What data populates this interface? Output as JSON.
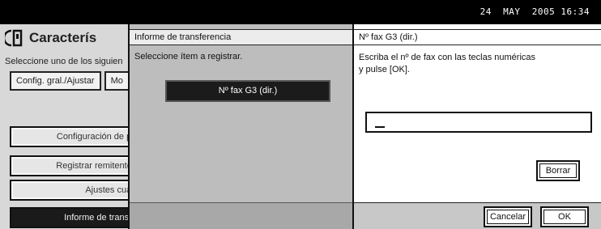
{
  "status_bar": {
    "date": "24  MAY",
    "time": "2005 16:34"
  },
  "left_panel": {
    "title": "Caracterís",
    "instruction": "Seleccione uno de los siguien",
    "tabs": [
      "Config. gral./Ajustar",
      "Mo"
    ],
    "buttons": [
      "Configuración de par",
      "Registrar remitente e",
      "Ajustes cuadr",
      "Informe de transfer"
    ]
  },
  "middle_panel": {
    "header": "Informe de transferencia",
    "instruction": "Seleccione ítem a registrar.",
    "option": "Nº fax G3 (dir.)"
  },
  "dialog": {
    "title": "Nº fax G3 (dir.)",
    "message": "Escriba el nº de fax con las teclas numéricas\ny pulse [OK].",
    "input_value": "",
    "clear_label": "Borrar",
    "cancel_label": "Cancelar",
    "ok_label": "OK"
  },
  "colors": {
    "bar": "#000000",
    "panel_light": "#d8d8d8",
    "panel_mid": "#bdbdbd",
    "selected": "#1b1b1b"
  }
}
